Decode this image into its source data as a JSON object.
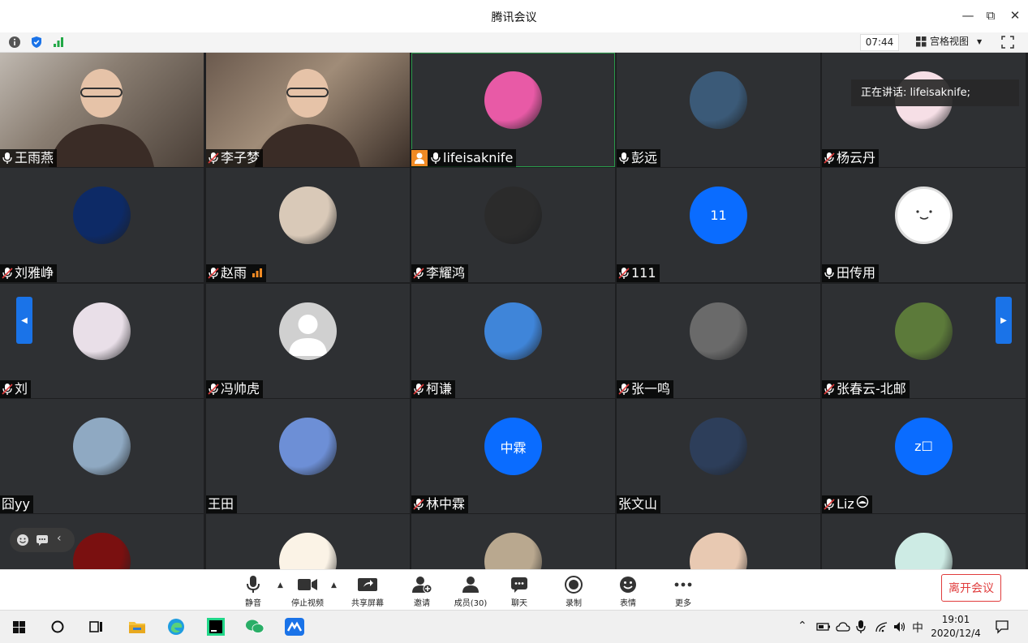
{
  "window": {
    "title": "腾讯会议",
    "minimize": "—",
    "restore": "⧉",
    "close": "✕"
  },
  "infobar": {
    "time": "07:44",
    "view_label": "宫格视图",
    "view_caret": "▼"
  },
  "speaking": {
    "text": "正在讲话: lifeisaknife;"
  },
  "participants": [
    {
      "name": "王雨燕",
      "mic": "on",
      "kind": "video",
      "style": "video1"
    },
    {
      "name": "李子梦",
      "mic": "muted",
      "kind": "video",
      "style": "video2"
    },
    {
      "name": "lifeisaknife",
      "mic": "on",
      "kind": "image",
      "color": "#e85aa6",
      "host": true,
      "active": true
    },
    {
      "name": "彭远",
      "mic": "on",
      "kind": "image",
      "color": "#3b5a78"
    },
    {
      "name": "杨云丹",
      "mic": "muted",
      "kind": "image",
      "color": "#f6dfe6"
    },
    {
      "name": "刘雅峥",
      "mic": "muted",
      "kind": "image",
      "color": "#0d2a66"
    },
    {
      "name": "赵雨",
      "mic": "muted",
      "kind": "image",
      "color": "#d9c9b8",
      "signal": true
    },
    {
      "name": "李耀鸿",
      "mic": "muted",
      "kind": "image",
      "color": "#2b2b2b"
    },
    {
      "name": "111",
      "mic": "muted",
      "kind": "text",
      "initials": "11",
      "color": "#0a6cff"
    },
    {
      "name": "田传用",
      "mic": "on",
      "kind": "face",
      "color": "#ffffff"
    },
    {
      "name": "刘",
      "mic": "muted",
      "kind": "image",
      "color": "#e9dfe8"
    },
    {
      "name": "冯帅虎",
      "mic": "muted",
      "kind": "default",
      "color": "#d0d0d0"
    },
    {
      "name": "柯谦",
      "mic": "muted",
      "kind": "image",
      "color": "#3f85d9"
    },
    {
      "name": "张一鸣",
      "mic": "muted",
      "kind": "image",
      "color": "#6a6a6a"
    },
    {
      "name": "张春云-北邮",
      "mic": "muted",
      "kind": "image",
      "color": "#5c7a3a"
    },
    {
      "name": "囧yy",
      "mic": "none",
      "kind": "image",
      "color": "#8fa9c2"
    },
    {
      "name": "王田",
      "mic": "none",
      "kind": "image",
      "color": "#6d8fd6"
    },
    {
      "name": "林中霖",
      "mic": "muted",
      "kind": "text",
      "initials": "中霖",
      "color": "#0a6cff"
    },
    {
      "name": "张文山",
      "mic": "none",
      "kind": "image",
      "color": "#2d3e5a"
    },
    {
      "name": "Liz",
      "mic": "muted",
      "kind": "text",
      "initials": "z☐",
      "color": "#0a6cff",
      "suffix": true
    },
    {
      "name": "",
      "mic": "none",
      "kind": "image",
      "color": "#7a1010"
    },
    {
      "name": "",
      "mic": "none",
      "kind": "image",
      "color": "#fbf3e6"
    },
    {
      "name": "",
      "mic": "none",
      "kind": "image",
      "color": "#b9a88f"
    },
    {
      "name": "",
      "mic": "none",
      "kind": "image",
      "color": "#e8c9b2"
    },
    {
      "name": "",
      "mic": "none",
      "kind": "image",
      "color": "#cdebe4"
    }
  ],
  "toolbar": {
    "mute": "静音",
    "stop_video": "停止视频",
    "share_screen": "共享屏幕",
    "invite": "邀请",
    "members": "成员(30)",
    "chat": "聊天",
    "record": "录制",
    "emoji": "表情",
    "more": "更多",
    "leave": "离开会议"
  },
  "taskbar": {
    "time": "19:01",
    "date": "2020/12/4",
    "ime": "中"
  },
  "colors": {
    "accent": "#0a6cff",
    "leave": "#e03c3c",
    "grid_bg": "#1e1f21",
    "tile_bg": "#2e3033"
  }
}
